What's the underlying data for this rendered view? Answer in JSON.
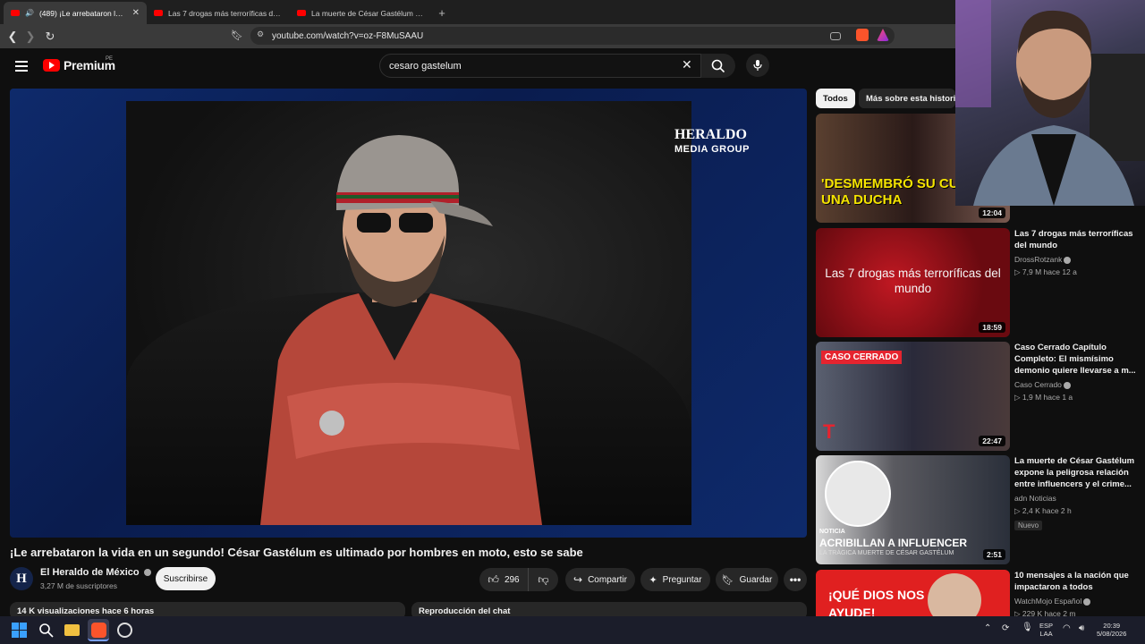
{
  "browser": {
    "tabs": [
      {
        "title": "(489) ¡Le arrebataron la vida en un segundo! César Gastélum",
        "active": true
      },
      {
        "title": "Las 7 drogas más terroríficas del mundo",
        "active": false
      },
      {
        "title": "La muerte de César Gastélum expone la peligrosa relación",
        "active": false
      }
    ],
    "url": "youtube.com/watch?v=oz-F8MuSAAU"
  },
  "yt": {
    "logo_text": "Premium",
    "logo_country": "PE",
    "search_value": "cesaro gastelum"
  },
  "player": {
    "watermark_line1": "HERALDO",
    "watermark_line2": "MEDIA GROUP"
  },
  "video": {
    "title": "¡Le arrebataron la vida en un segundo! César Gastélum es ultimado por hombres en moto, esto se sabe",
    "channel": "El Heraldo de México",
    "channel_initial": "H",
    "subscribers": "3,27 M de suscriptores",
    "subscribe_label": "Suscribirse",
    "likes": "296",
    "share_label": "Compartir",
    "ask_label": "Preguntar",
    "save_label": "Guardar",
    "views_line": "14 K visualizaciones  hace 6 horas",
    "chat_replay": "Reproducción del chat"
  },
  "sidebar": {
    "chips": [
      "Todos",
      "Más sobre esta historia"
    ],
    "items": [
      {
        "thumb_text": "'DESMEMBRÓ SU CU EN UNA DUCHA",
        "duration": "12:04",
        "title": "",
        "channel": "",
        "stats": "",
        "thumb_color": "#3a2a20"
      },
      {
        "thumb_text": "Las 7 drogas más terroríficas del mundo",
        "duration": "18:59",
        "title": "Las 7 drogas más terroríficas del mundo",
        "channel": "DrossRotzank",
        "stats": "7,9 M  hace 12 a",
        "thumb_color": "#8a0f14"
      },
      {
        "thumb_text": "CASO CERRADO",
        "duration": "22:47",
        "title": "Caso Cerrado Capítulo Completo: El mismísimo demonio quiere llevarse a m...",
        "channel": "Caso Cerrado",
        "stats": "1,9 M  hace 1 a",
        "thumb_color": "#3a3a4a"
      },
      {
        "thumb_text": "ACRIBILLAN A INFLUENCER",
        "thumb_sub": "LA TRÁGICA MUERTE DE CÉSAR GASTÉLUM",
        "thumb_tag": "NOTICIA",
        "duration": "2:51",
        "title": "La muerte de César Gastélum expone la peligrosa relación entre influencers y el crime...",
        "channel": "adn Noticias",
        "stats": "2,4 K  hace 2 h",
        "badge": "Nuevo",
        "thumb_color": "#2a2f3a"
      },
      {
        "thumb_text": "¡QUÉ DIOS NOS AYUDE!",
        "duration": "",
        "title": "10 mensajes a la nación que impactaron a todos",
        "channel": "WatchMojo Español",
        "stats": "229 K  hace 2 m",
        "thumb_color": "#e02020"
      }
    ]
  },
  "taskbar": {
    "lang_top": "ESP",
    "lang_bottom": "LAA",
    "time": "20:39",
    "date": "5/08/2026"
  },
  "colors": {
    "yt_red": "#ff0000",
    "bg": "#0f0f0f",
    "pill": "#272727"
  }
}
